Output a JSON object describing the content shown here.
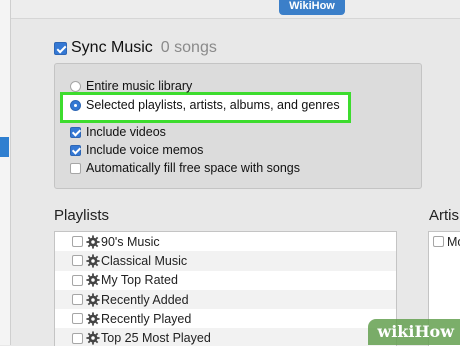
{
  "device_tab": {
    "label": "WikiHow"
  },
  "sync": {
    "title": "Sync Music",
    "count": "0 songs",
    "checked": true
  },
  "options": {
    "entire_library": "Entire music library",
    "selected": "Selected playlists, artists, albums, and genres",
    "include_videos": "Include videos",
    "include_voice_memos": "Include voice memos",
    "autofill": "Automatically fill free space with songs"
  },
  "playlists": {
    "heading": "Playlists",
    "items": [
      {
        "label": "90's Music"
      },
      {
        "label": "Classical Music"
      },
      {
        "label": "My Top Rated"
      },
      {
        "label": "Recently Added"
      },
      {
        "label": "Recently Played"
      },
      {
        "label": "Top 25 Most Played"
      }
    ]
  },
  "artists": {
    "heading": "Artis",
    "items": [
      {
        "label": "Mo"
      }
    ]
  },
  "watermark": {
    "text": "wikiHow"
  },
  "icons": {
    "playlist": "gear-icon",
    "check": "checkmark-icon"
  },
  "colors": {
    "accent": "#3478d4",
    "highlight": "#3ddc2e",
    "tab": "#3b7fc9"
  }
}
